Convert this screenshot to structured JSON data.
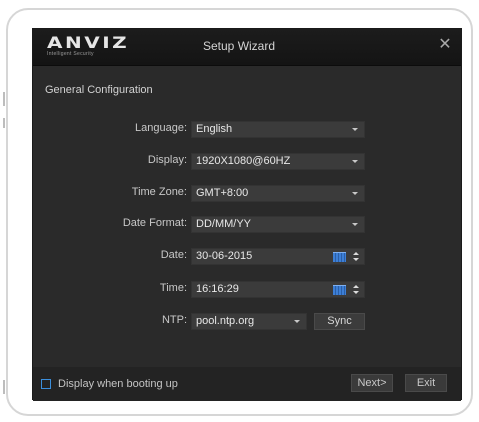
{
  "window": {
    "logo": {
      "word": "ANVIZ",
      "tagline": "Intelligent Security"
    },
    "title": "Setup Wizard",
    "close_icon": "close-icon"
  },
  "section_title": "General Configuration",
  "form": {
    "language": {
      "label": "Language:",
      "value": "English"
    },
    "display": {
      "label": "Display:",
      "value": "1920X1080@60HZ"
    },
    "time_zone": {
      "label": "Time Zone:",
      "value": "GMT+8:00"
    },
    "date_format": {
      "label": "Date Format:",
      "value": "DD/MM/YY"
    },
    "date": {
      "label": "Date:",
      "value": "30-06-2015"
    },
    "time": {
      "label": "Time:",
      "value": "16:16:29"
    },
    "ntp": {
      "label": "NTP:",
      "value": "pool.ntp.org",
      "sync_label": "Sync"
    }
  },
  "footer": {
    "boot_checkbox_label": "Display when booting up",
    "boot_checked": false,
    "next_label": "Next>",
    "exit_label": "Exit"
  },
  "colors": {
    "window_bg": "#2a2a2a",
    "titlebar_bg": "#161616",
    "field_bg": "#3b3b3b",
    "accent_blue": "#3c8fdc"
  }
}
